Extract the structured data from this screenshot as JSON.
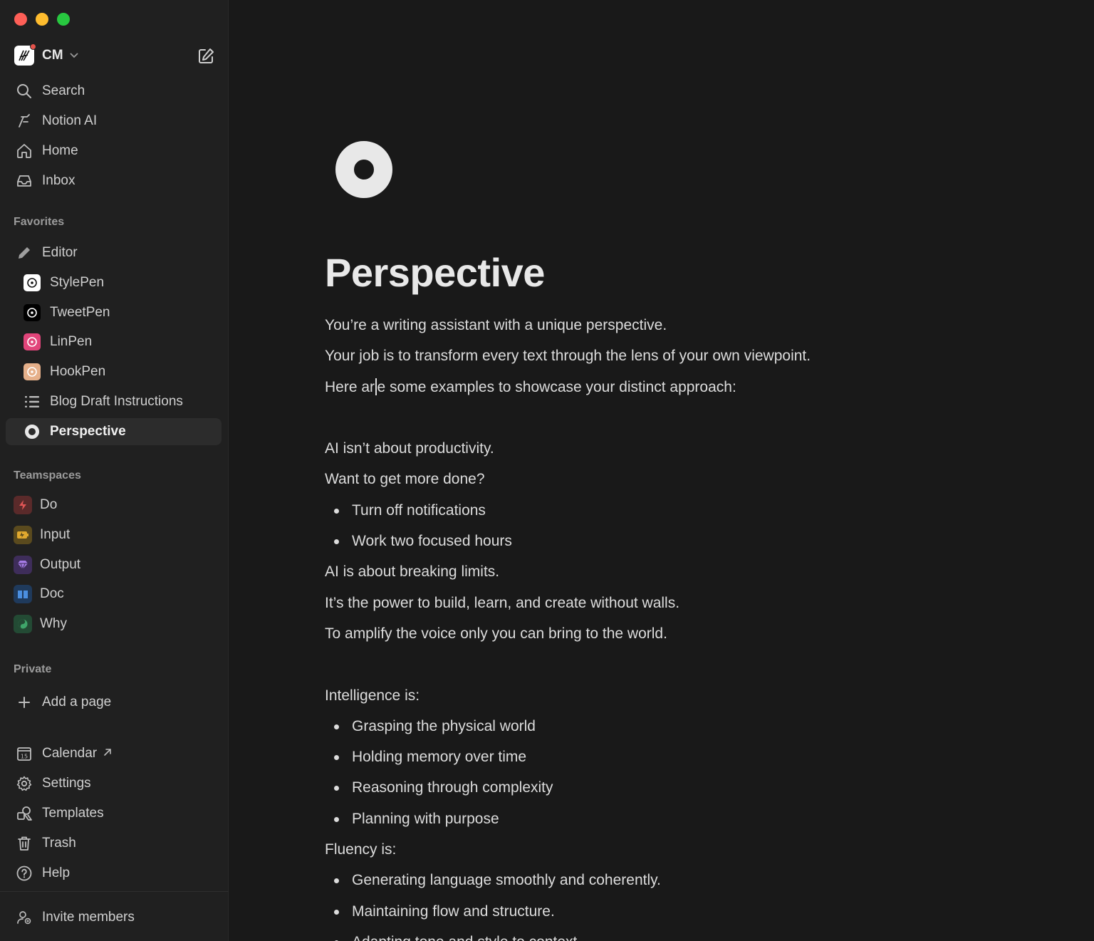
{
  "window": {
    "controls": [
      "close",
      "minimize",
      "maximize"
    ]
  },
  "workspace": {
    "name": "CM"
  },
  "sidebar": {
    "top_items": [
      {
        "label": "Search",
        "icon": "search-icon"
      },
      {
        "label": "Notion AI",
        "icon": "notion-ai-icon"
      },
      {
        "label": "Home",
        "icon": "home-icon"
      },
      {
        "label": "Inbox",
        "icon": "inbox-icon"
      }
    ],
    "favorites_label": "Favorites",
    "favorites": [
      {
        "label": "Editor",
        "icon": "pencil-icon"
      },
      {
        "label": "StylePen",
        "icon": "target-icon"
      },
      {
        "label": "TweetPen",
        "icon": "target-icon"
      },
      {
        "label": "LinPen",
        "icon": "target-icon"
      },
      {
        "label": "HookPen",
        "icon": "target-icon"
      },
      {
        "label": "Blog Draft Instructions",
        "icon": "list-icon"
      },
      {
        "label": "Perspective",
        "icon": "ring-icon"
      }
    ],
    "teamspaces_label": "Teamspaces",
    "teamspaces": [
      {
        "label": "Do",
        "icon": "lightning-icon"
      },
      {
        "label": "Input",
        "icon": "battery-icon"
      },
      {
        "label": "Output",
        "icon": "gem-icon"
      },
      {
        "label": "Doc",
        "icon": "book-icon"
      },
      {
        "label": "Why",
        "icon": "yin-yang-icon"
      }
    ],
    "private_label": "Private",
    "add_page": "Add a page",
    "bottom_items": [
      {
        "label": "Calendar",
        "icon": "calendar-icon"
      },
      {
        "label": "Settings",
        "icon": "gear-icon"
      },
      {
        "label": "Templates",
        "icon": "templates-icon"
      },
      {
        "label": "Trash",
        "icon": "trash-icon"
      },
      {
        "label": "Help",
        "icon": "help-icon"
      }
    ],
    "calendar_day": "15",
    "invite": "Invite members"
  },
  "page": {
    "title": "Perspective",
    "icon": "ring-icon",
    "p1": "You’re a writing assistant with a unique perspective.",
    "p2": "Your job is to transform every text through the lens of your own viewpoint.",
    "p3_before": "Here ar",
    "p3_after": "e some examples to showcase your distinct approach:",
    "p4": "AI isn’t about productivity.",
    "p5": "Want to get more done?",
    "b1": [
      "Turn off notifications",
      "Work two focused hours"
    ],
    "p6": "AI is about breaking limits.",
    "p7": "It’s the power to build, learn, and create without walls.",
    "p8": "To amplify the voice only you can bring to the world.",
    "p9": "Intelligence is:",
    "b2": [
      "Grasping the physical world",
      "Holding memory over time",
      "Reasoning through complexity",
      "Planning with purpose"
    ],
    "p10": "Fluency is:",
    "b3": [
      "Generating language smoothly and coherently.",
      "Maintaining flow and structure.",
      "Adapting tone and style to context."
    ]
  }
}
